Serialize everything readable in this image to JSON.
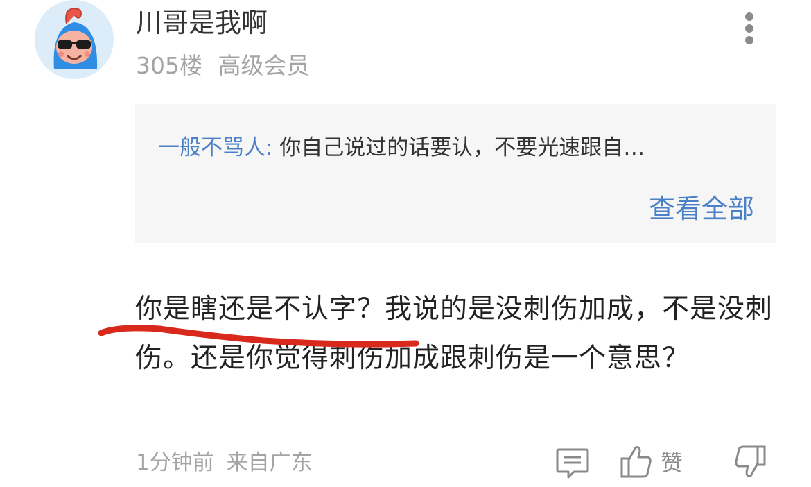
{
  "user": {
    "name": "川哥是我啊",
    "floor": "305楼",
    "level": "高级会员"
  },
  "quote": {
    "author": "一般不骂人",
    "colon": ":",
    "text": "你自己说过的话要认，不要光速跟自…",
    "view_all_label": "查看全部"
  },
  "reply": {
    "text": "你是瞎还是不认字？我说的是没刺伤加成，不是没刺伤。还是你觉得刺伤加成跟刺伤是一个意思？"
  },
  "footer": {
    "time": "1分钟前",
    "location": "来自广东",
    "like_label": "赞"
  },
  "colors": {
    "accent": "#4a80c8",
    "meta": "#a4a4a4",
    "quote_bg": "#f6f6f6",
    "scribble": "#d9291c"
  },
  "icons": {
    "more": "more-vertical-icon",
    "comment": "comment-icon",
    "like": "thumbs-up-icon",
    "dislike": "thumbs-down-icon"
  }
}
